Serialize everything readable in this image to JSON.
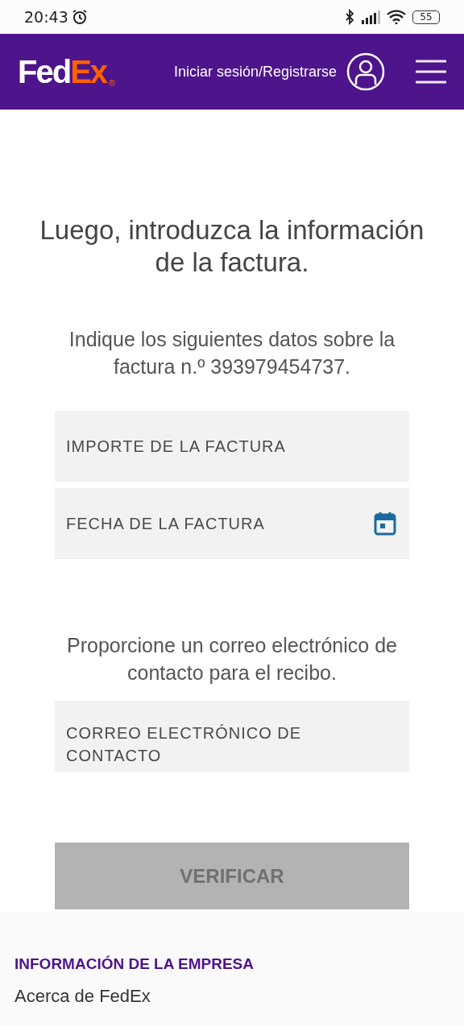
{
  "status_bar": {
    "time": "20:43",
    "battery": "55"
  },
  "header": {
    "logo": {
      "part_1": "Fed",
      "part_2": "Ex",
      "mark": "®"
    },
    "login_link": "Iniciar sesión/Registrarse"
  },
  "heading": "Luego, introduzca la información de la factura.",
  "intro": "Indique los siguientes datos sobre la factura n.º 393979454737.",
  "invoice_fields": [
    {
      "placeholder": "IMPORTE DE LA FACTURA",
      "kind": "text"
    },
    {
      "placeholder": "FECHA DE LA FACTURA",
      "kind": "date"
    }
  ],
  "email_prompt": "Proporcione un correo electrónico de contacto para el recibo.",
  "email_field": {
    "placeholder": "CORREO ELECTRÓNICO DE CONTACTO"
  },
  "verify_button": {
    "label": "VERIFICAR",
    "disabled": true
  },
  "footer": {
    "heading": "INFORMACIÓN DE LA EMPRESA",
    "links": [
      "Acerca de FedEx"
    ]
  }
}
